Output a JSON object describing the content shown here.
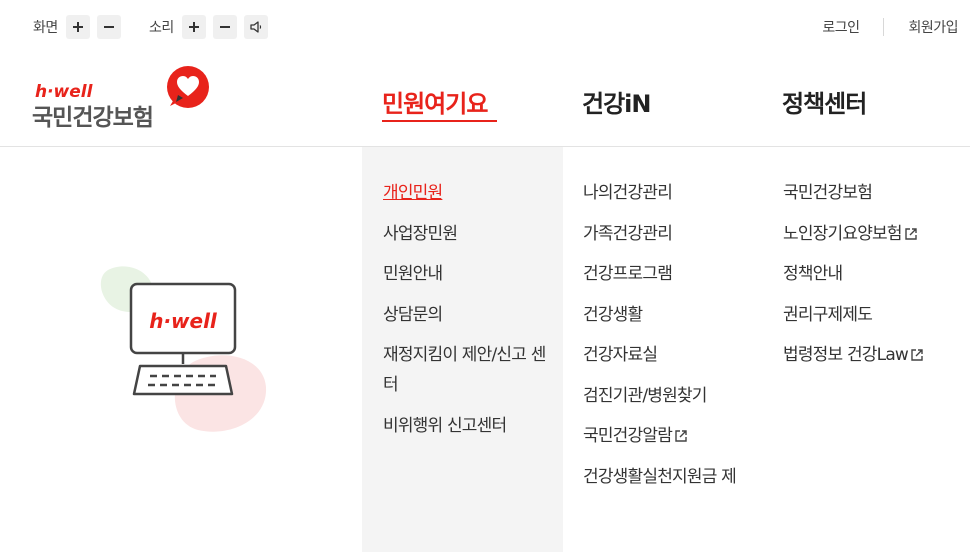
{
  "utility": {
    "screen_label": "화면",
    "sound_label": "소리",
    "login": "로그인",
    "signup": "회원가입"
  },
  "logo": {
    "small": "h·well",
    "big": "국민건강보험"
  },
  "gnb": [
    {
      "label": "민원여기요",
      "active": true
    },
    {
      "label": "건강iN",
      "active": false
    },
    {
      "label": "정책센터",
      "active": false
    }
  ],
  "submenu": {
    "col1": [
      "개인민원",
      "사업장민원",
      "민원안내",
      "상담문의",
      "재정지킴이 제안/신고 센터",
      "비위행위 신고센터"
    ],
    "col2": [
      "나의건강관리",
      "가족건강관리",
      "건강프로그램",
      "건강생활",
      "건강자료실",
      "검진기관/병원찾기",
      "국민건강알람",
      "건강생활실천지원금 제"
    ],
    "col3": [
      "국민건강보험",
      "노인장기요양보험",
      "정책안내",
      "권리구제제도",
      "법령정보 건강Law"
    ]
  },
  "illustration": {
    "screen_text": "h·well"
  },
  "colors": {
    "accent": "#e8231b",
    "active_bg": "#f4f4f4"
  }
}
